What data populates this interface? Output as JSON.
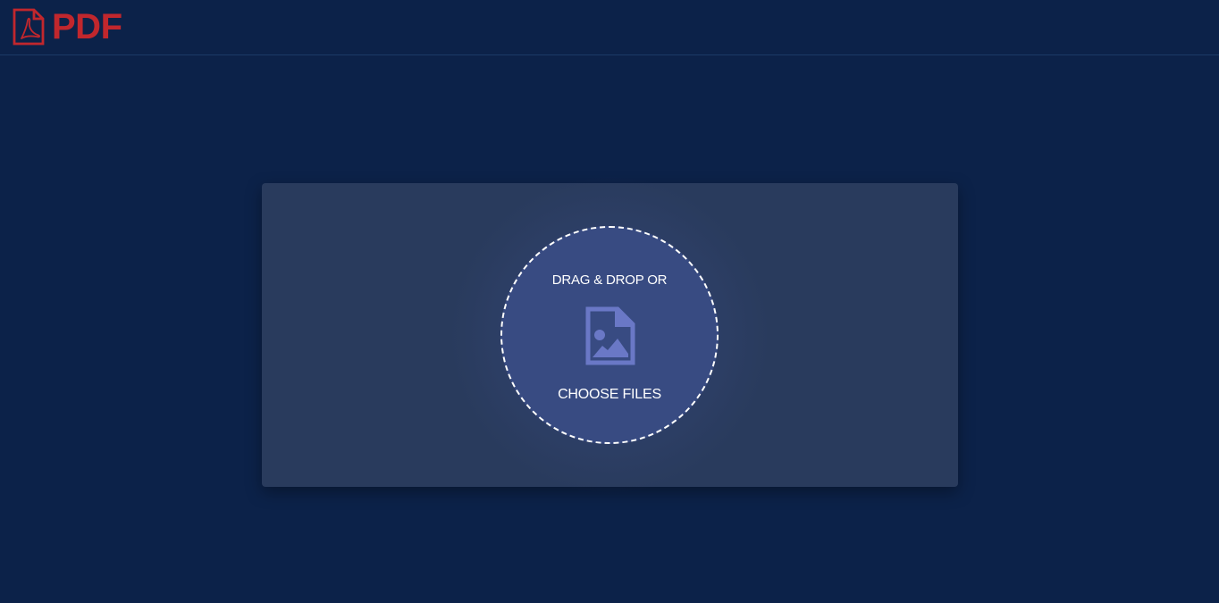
{
  "header": {
    "logo_text": "PDF",
    "logo_icon": "pdf-document-icon",
    "brand_color": "#c1272d"
  },
  "upload": {
    "drag_text": "DRAG & DROP OR",
    "choose_text": "CHOOSE FILES",
    "icon": "image-file-icon",
    "icon_color": "#6a78c6"
  },
  "colors": {
    "background": "#0c2249",
    "panel": "#293b5d",
    "circle": "#384b82"
  }
}
